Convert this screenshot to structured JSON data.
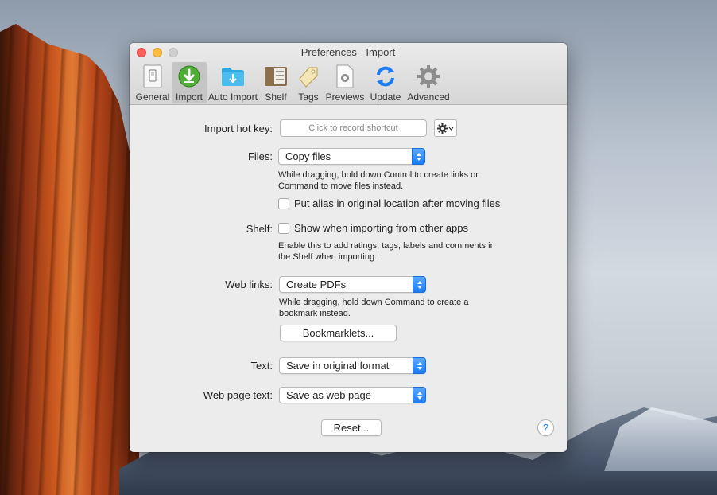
{
  "window": {
    "title": "Preferences - Import"
  },
  "toolbar": {
    "items": [
      {
        "label": "General",
        "icon": "general-icon",
        "selected": false
      },
      {
        "label": "Import",
        "icon": "import-icon",
        "selected": true
      },
      {
        "label": "Auto Import",
        "icon": "auto-import-icon",
        "selected": false
      },
      {
        "label": "Shelf",
        "icon": "shelf-icon",
        "selected": false
      },
      {
        "label": "Tags",
        "icon": "tags-icon",
        "selected": false
      },
      {
        "label": "Previews",
        "icon": "previews-icon",
        "selected": false
      },
      {
        "label": "Update",
        "icon": "update-icon",
        "selected": false
      },
      {
        "label": "Advanced",
        "icon": "advanced-icon",
        "selected": false
      }
    ]
  },
  "import": {
    "hotkey_label": "Import hot key:",
    "hotkey_placeholder": "Click to record shortcut",
    "files_label": "Files:",
    "files_value": "Copy files",
    "files_help": "While dragging, hold down Control to create links or\nCommand to move files instead.",
    "alias_checkbox": "Put alias in original location after moving files",
    "alias_checked": false,
    "shelf_label": "Shelf:",
    "shelf_checkbox": "Show when importing from other apps",
    "shelf_checked": false,
    "shelf_help": "Enable this to add ratings, tags, labels and comments in\nthe Shelf when importing.",
    "weblinks_label": "Web links:",
    "weblinks_value": "Create PDFs",
    "weblinks_help": "While dragging, hold down Command to create a\nbookmark instead.",
    "bookmarklets_button": "Bookmarklets...",
    "text_label": "Text:",
    "text_value": "Save in original format",
    "webpage_label": "Web page text:",
    "webpage_value": "Save as web page",
    "reset_button": "Reset...",
    "help_button": "?"
  },
  "colors": {
    "accent": "#1c7cf4",
    "close": "#fc605c",
    "minimize": "#fdbc40",
    "zoom": "#cfcfcf"
  }
}
